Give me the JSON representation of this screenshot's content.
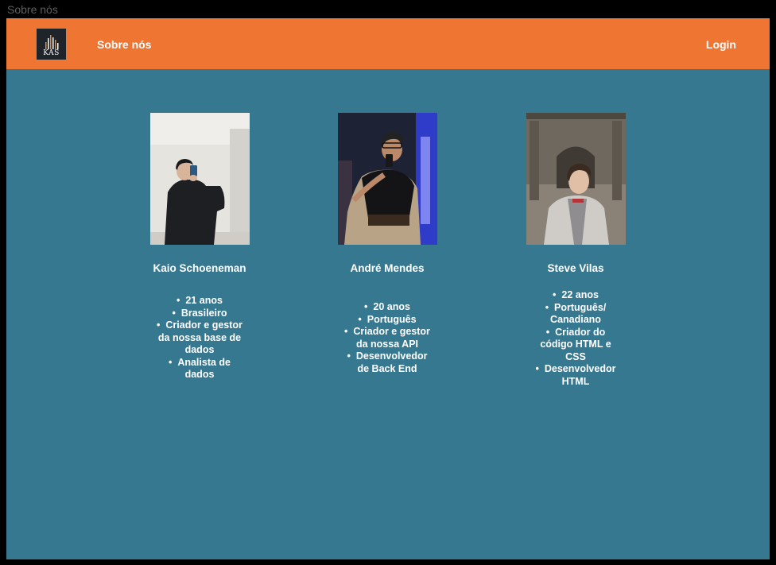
{
  "window": {
    "title": "Sobre nós"
  },
  "navbar": {
    "logo_text": "KAS",
    "about_label": "Sobre nós",
    "login_label": "Login"
  },
  "members": [
    {
      "name": "Kaio Schoeneman",
      "bullets": [
        "21 anos",
        "Brasileiro",
        "Criador e gestor da nossa base de dados",
        "Analista de dados"
      ]
    },
    {
      "name": "André Mendes",
      "bullets": [
        "20 anos",
        "Português",
        "Criador e gestor da nossa API",
        "Desenvolvedor de Back End"
      ]
    },
    {
      "name": "Steve Vilas",
      "bullets": [
        "22 anos",
        "Português/ Canadiano",
        "Criador do código HTML e CSS",
        "Desenvolvedor HTML"
      ]
    }
  ],
  "colors": {
    "navbar": "#ee7632",
    "background": "#377891",
    "logo_bg": "#1f232a",
    "text": "#ffffff"
  }
}
